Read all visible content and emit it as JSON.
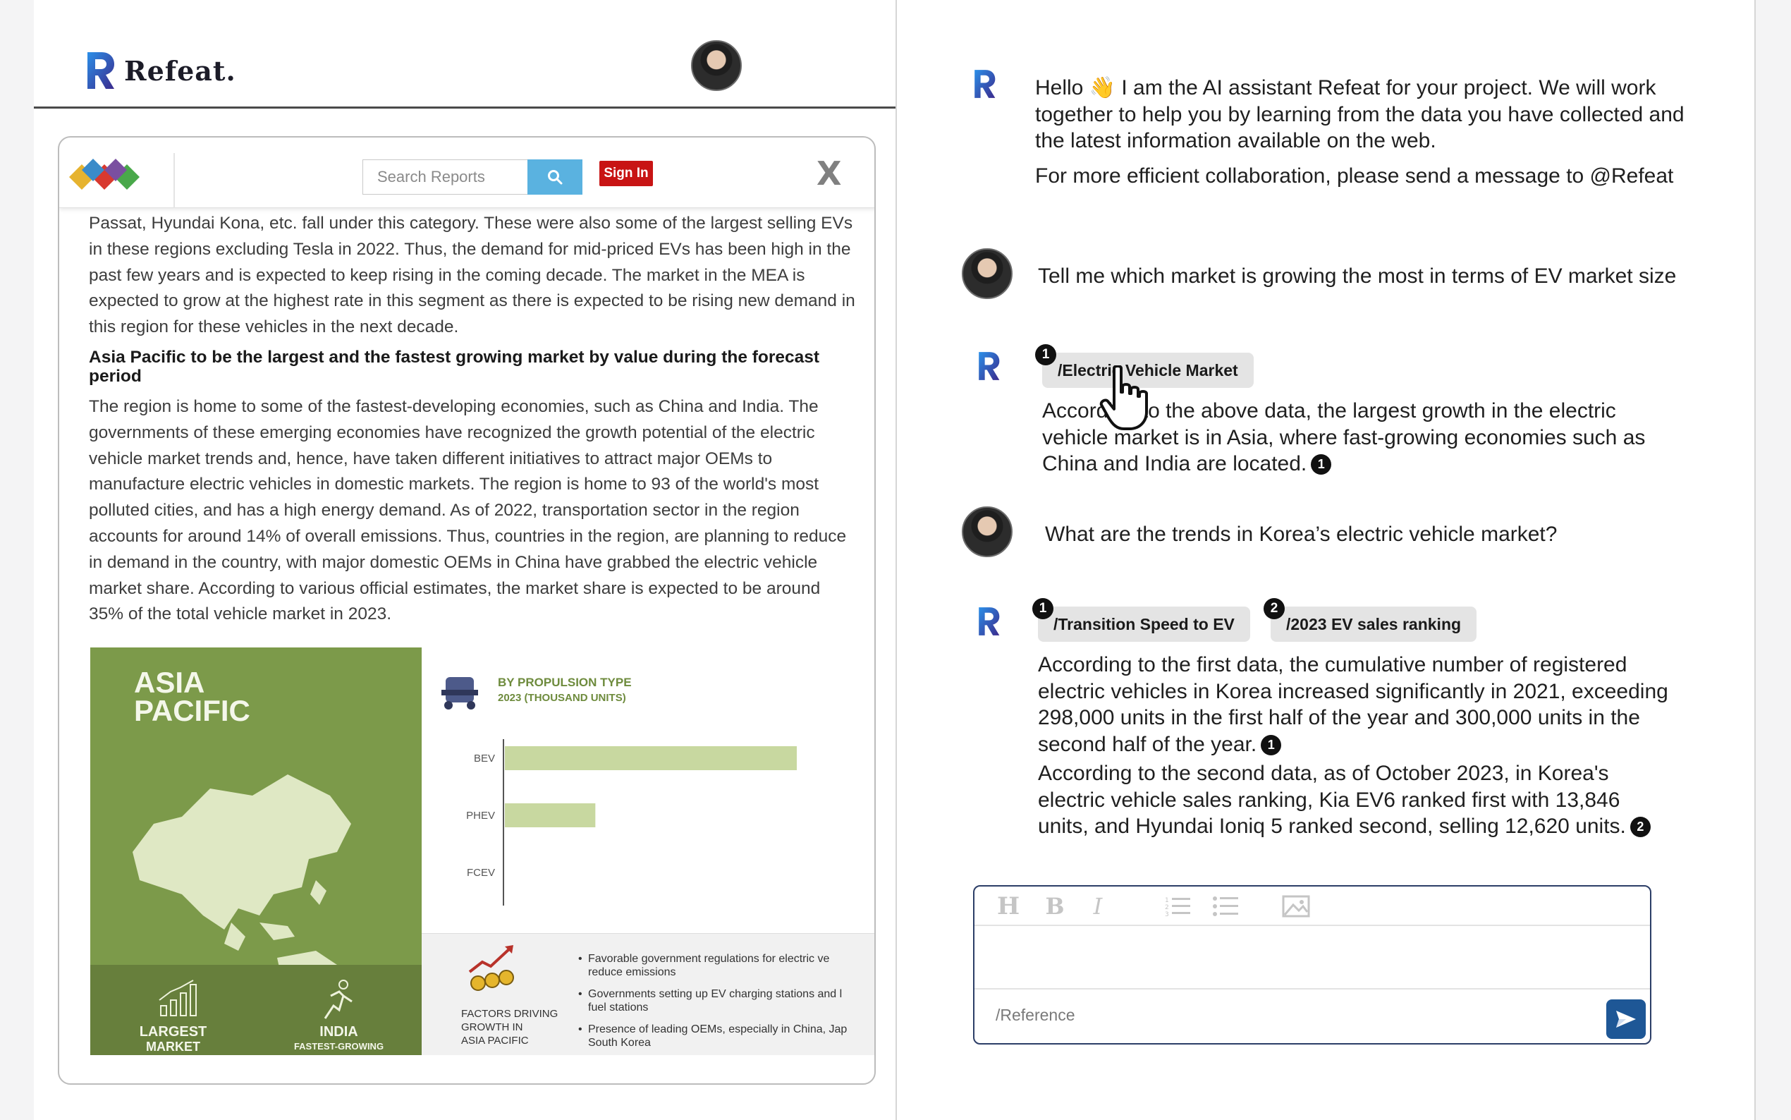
{
  "app": {
    "name": "Refeat."
  },
  "browser": {
    "search_placeholder": "Search Reports",
    "signin_label": "Sign In",
    "close_label": "X",
    "article": {
      "para1": "Passat, Hyundai Kona, etc. fall under this category. These were also some of the largest selling EVs in these regions excluding Tesla in 2022. Thus, the demand for mid-priced EVs has been high in the past few years and is expected to keep rising in the coming decade. The market in the MEA is expected to grow at the highest rate in this segment as there is expected to be rising new demand in this region for these vehicles in the next decade.",
      "heading": "Asia Pacific to be the largest and the fastest growing market by value during the forecast period",
      "para2": "The region is home to some of the fastest-developing economies, such as China and India. The governments of these emerging economies have recognized the growth potential of the electric vehicle market trends and, hence, have taken different initiatives to attract major OEMs to manufacture electric vehicles in domestic markets. The region is home to 93 of the world's most polluted cities, and has a high energy demand. As of 2022, transportation sector in the region accounts for around 14% of overall emissions. Thus, countries in the region, are planning to reduce in demand in the country, with major domestic OEMs in China have grabbed the electric vehicle market share. According to various official estimates, the market share is expected to be around 35% of the total vehicle market in 2023."
    },
    "infographic": {
      "region_line1": "ASIA",
      "region_line2": "PACIFIC",
      "chart_title1": "BY PROPULSION TYPE",
      "chart_title2": "2023 (THOUSAND UNITS)",
      "bottom_left_line1": "LARGEST",
      "bottom_left_line2": "MARKET",
      "bottom_right_line1": "INDIA",
      "bottom_right_line2": "FASTEST-GROWING",
      "factors_title_1": "FACTORS DRIVING",
      "factors_title_2": "GROWTH IN",
      "factors_title_3": "ASIA PACIFIC",
      "factors": [
        {
          "line1": "Favorable government regulations for electric ve",
          "line2": "reduce emissions"
        },
        {
          "line1": "Governments setting up EV charging stations and l",
          "line2": "fuel stations"
        },
        {
          "line1": "Presence of leading OEMs, especially in China, Jap",
          "line2": "South Korea"
        }
      ]
    }
  },
  "chart_data": {
    "type": "bar",
    "orientation": "horizontal",
    "title": "BY PROPULSION TYPE",
    "subtitle": "2023 (THOUSAND UNITS)",
    "categories": [
      "BEV",
      "PHEV",
      "FCEV"
    ],
    "values": [
      100,
      31,
      0
    ],
    "color": "#c8d8a0"
  },
  "chat": {
    "greeting_p1": "Hello 👋 I am the AI assistant Refeat for your project. We will work together to help you by learning from the data you have collected and the latest information available on the web.",
    "greeting_p2": "For more efficient collaboration, please send a message to @Refeat",
    "user_q1": "Tell me which market is growing the most in terms of EV market size",
    "answer1_ref": "/Electric Vehicle Market",
    "answer1_ref_num": "1",
    "answer1_text": "According to the above data, the largest growth in the electric vehicle market is in Asia, where fast-growing economies such as China and India are located.",
    "answer1_cite": "1",
    "user_q2": "What are the trends in Korea’s electric vehicle market?",
    "answer2_ref1": "/Transition Speed to EV",
    "answer2_ref1_num": "1",
    "answer2_ref2": "/2023 EV sales ranking",
    "answer2_ref2_num": "2",
    "answer2_p1": "According to the first data, the cumulative number of registered electric vehicles in Korea increased significantly in 2021, exceeding 298,000 units in the first half of the year and 300,000 units in the second half of the year.",
    "answer2_p1_cite": "1",
    "answer2_p2": "According to the second data, as of October 2023, in Korea's electric vehicle sales ranking, Kia EV6 ranked first with 13,846 units, and Hyundai Ioniq 5 ranked second, selling 12,620 units.",
    "answer2_p2_cite": "2"
  },
  "editor": {
    "toolbar": {
      "heading": "H",
      "bold": "B",
      "italic": "I"
    },
    "input_placeholder": "/Reference"
  },
  "icons": {
    "pointer": "hand-pointer-icon",
    "send": "send-icon",
    "search": "search-icon"
  },
  "colors": {
    "brand_gradient_start": "#2b8fe8",
    "brand_gradient_end": "#3b2a8c",
    "infographic_green": "#7c9a4a",
    "send_button": "#1e5796",
    "signin_red": "#c81414"
  }
}
